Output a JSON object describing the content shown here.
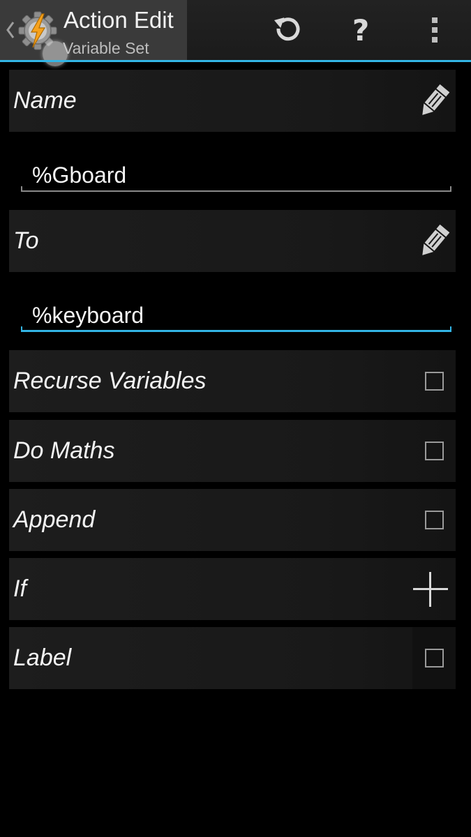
{
  "actionbar": {
    "title": "Action Edit",
    "subtitle": "Variable Set",
    "icons": {
      "up": "chevron-left-icon",
      "app": "tasker-gear-bolt-icon",
      "refresh": "refresh-icon",
      "help": "help-icon",
      "overflow": "overflow-menu-icon"
    },
    "help_glyph": "?",
    "accent_color": "#33b5e5"
  },
  "fields": {
    "name": {
      "label": "Name",
      "value": "%Gboard",
      "icon": "pencil-icon"
    },
    "to": {
      "label": "To",
      "value": "%keyboard",
      "icon": "pencil-icon",
      "focused": true
    }
  },
  "options": {
    "recurse_variables": {
      "label": "Recurse Variables",
      "checked": false
    },
    "do_maths": {
      "label": "Do Maths",
      "checked": false
    },
    "append": {
      "label": "Append",
      "checked": false
    },
    "if": {
      "label": "If",
      "icon": "plus-icon"
    },
    "label": {
      "label": "Label",
      "checked": false
    }
  }
}
